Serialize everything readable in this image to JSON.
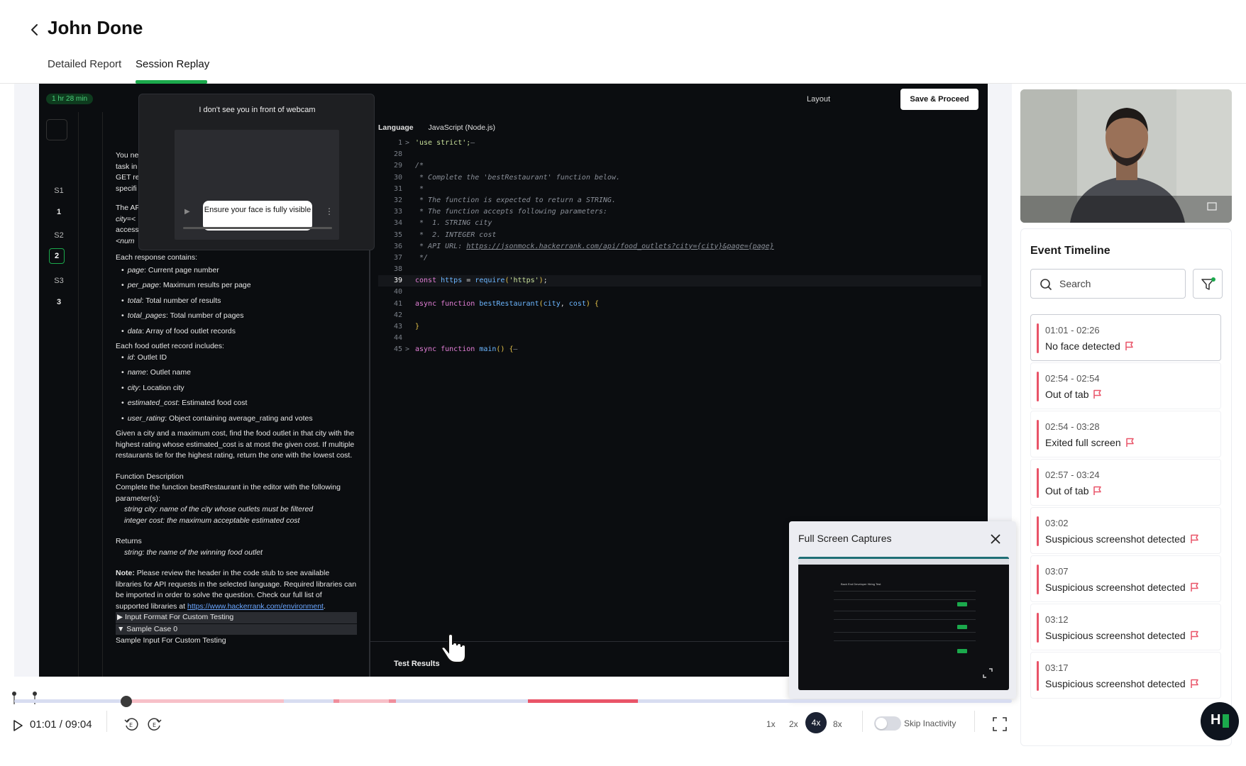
{
  "header": {
    "title": "John Done",
    "tabs": [
      {
        "label": "Detailed Report"
      },
      {
        "label": "Session Replay"
      }
    ]
  },
  "video": {
    "timer": "1 hr 28 min",
    "layout_label": "Layout",
    "save_button": "Save & Proceed",
    "question_nav": [
      "S1",
      "1",
      "S2",
      "2",
      "S3",
      "3"
    ],
    "webcam_warning": "I don't see you in front of webcam",
    "face_tooltip": "Ensure your face is fully visible",
    "language_label": "Language",
    "language_value": "JavaScript (Node.js)",
    "test_results": "Test Results",
    "problem": {
      "intro_fragments": [
        "You ne",
        "task in",
        "GET re",
        "specifi"
      ],
      "api_fragments": [
        "The AP",
        "city=<",
        "access",
        "<num"
      ],
      "response_heading": "Each response contains:",
      "response_items": [
        {
          "key": "page",
          "text": ": Current page number"
        },
        {
          "key": "per_page",
          "text": ": Maximum results per page"
        },
        {
          "key": "total",
          "text": ": Total number of results"
        },
        {
          "key": "total_pages",
          "text": ": Total number of pages"
        },
        {
          "key": "data",
          "text": ": Array of food outlet records"
        }
      ],
      "record_heading": "Each food outlet record includes:",
      "record_items": [
        {
          "key": "id",
          "text": ": Outlet ID"
        },
        {
          "key": "name",
          "text": ": Outlet name"
        },
        {
          "key": "city",
          "text": ": Location city"
        },
        {
          "key": "estimated_cost",
          "text": ": Estimated food cost"
        },
        {
          "key": "user_rating",
          "text": ": Object containing average_rating and votes"
        }
      ],
      "task": "Given a city and a maximum cost, find the food outlet in that city with the highest rating whose estimated_cost is at most the given cost. If multiple restaurants tie for the highest rating, return the one with the lowest cost.",
      "fd_heading": "Function Description",
      "fd_text": "Complete the function bestRestaurant in the editor with the following parameter(s):",
      "param1": "string city: name of the city whose outlets must be filtered",
      "param2": "integer cost: the maximum acceptable estimated cost",
      "returns_heading": "Returns",
      "returns_text": "string: the name of the winning food outlet",
      "note_label": "Note:",
      "note_text": " Please review the header in the code stub to see available libraries for API requests in the selected language. Required libraries can be imported in order to solve the question. Check our full list of supported libraries at ",
      "note_link": "https://www.hackerrank.com/environment",
      "input_format": "▶ Input Format For Custom Testing",
      "sample_case": "▼ Sample Case 0",
      "sample_input": "Sample Input For Custom Testing"
    },
    "code": [
      {
        "n": "1",
        "fold": ">",
        "parts": [
          [
            "c-str",
            "'use strict';"
          ],
          [
            "c-com",
            "—"
          ]
        ]
      },
      {
        "n": "28",
        "fold": "",
        "parts": []
      },
      {
        "n": "29",
        "fold": "",
        "parts": [
          [
            "c-com",
            "/*"
          ]
        ]
      },
      {
        "n": "30",
        "fold": "",
        "parts": [
          [
            "c-com",
            " * Complete the 'bestRestaurant' function below."
          ]
        ]
      },
      {
        "n": "31",
        "fold": "",
        "parts": [
          [
            "c-com",
            " *"
          ]
        ]
      },
      {
        "n": "32",
        "fold": "",
        "parts": [
          [
            "c-com",
            " * The function is expected to return a STRING."
          ]
        ]
      },
      {
        "n": "33",
        "fold": "",
        "parts": [
          [
            "c-com",
            " * The function accepts following parameters:"
          ]
        ]
      },
      {
        "n": "34",
        "fold": "",
        "parts": [
          [
            "c-com",
            " *  1. STRING city"
          ]
        ]
      },
      {
        "n": "35",
        "fold": "",
        "parts": [
          [
            "c-com",
            " *  2. INTEGER cost"
          ]
        ]
      },
      {
        "n": "36",
        "fold": "",
        "parts": [
          [
            "c-com",
            " * API URL: "
          ],
          [
            "c-url",
            "https://jsonmock.hackerrank.com/api/food_outlets?city={city}&page={page}"
          ]
        ]
      },
      {
        "n": "37",
        "fold": "",
        "parts": [
          [
            "c-com",
            " */"
          ]
        ]
      },
      {
        "n": "38",
        "fold": "",
        "parts": []
      },
      {
        "n": "39",
        "fold": "",
        "cur": true,
        "parts": [
          [
            "c-kw",
            "const "
          ],
          [
            "c-fn",
            "https"
          ],
          [
            "c-id",
            " = "
          ],
          [
            "c-fn",
            "require"
          ],
          [
            "c-br",
            "("
          ],
          [
            "c-str",
            "'https'"
          ],
          [
            "c-br",
            ")"
          ],
          [
            "c-id",
            ";"
          ]
        ]
      },
      {
        "n": "40",
        "fold": "",
        "parts": []
      },
      {
        "n": "41",
        "fold": "",
        "parts": [
          [
            "c-kw",
            "async function "
          ],
          [
            "c-fn",
            "bestRestaurant"
          ],
          [
            "c-br",
            "("
          ],
          [
            "c-fn",
            "city"
          ],
          [
            "c-id",
            ", "
          ],
          [
            "c-fn",
            "cost"
          ],
          [
            "c-br",
            ") {"
          ]
        ]
      },
      {
        "n": "42",
        "fold": "",
        "parts": []
      },
      {
        "n": "43",
        "fold": "",
        "parts": [
          [
            "c-br",
            "}"
          ]
        ]
      },
      {
        "n": "44",
        "fold": "",
        "parts": []
      },
      {
        "n": "45",
        "fold": ">",
        "parts": [
          [
            "c-kw",
            "async function "
          ],
          [
            "c-fn",
            "main"
          ],
          [
            "c-br",
            "() {"
          ],
          [
            "c-com",
            "—"
          ]
        ]
      }
    ]
  },
  "captures": {
    "title": "Full Screen Captures",
    "thumb_heading": "Back End Developer Hiring Test"
  },
  "playback": {
    "time": "01:01 / 09:04",
    "position_fraction": 0.112,
    "speeds": [
      "1x",
      "2x",
      "4x",
      "8x"
    ],
    "active_speed": "4x",
    "skip_inactivity": "Skip Inactivity",
    "skip_inactivity_on": false
  },
  "timeline": {
    "title": "Event Timeline",
    "search_placeholder": "Search",
    "accent": "#e95468",
    "events": [
      {
        "time": "01:01 - 02:26",
        "label": "No face detected",
        "selected": true
      },
      {
        "time": "02:54 - 02:54",
        "label": "Out of tab"
      },
      {
        "time": "02:54 - 03:28",
        "label": "Exited full screen"
      },
      {
        "time": "02:57 - 03:24",
        "label": "Out of tab"
      },
      {
        "time": "03:02",
        "label": "Suspicious screenshot detected"
      },
      {
        "time": "03:07",
        "label": "Suspicious screenshot detected"
      },
      {
        "time": "03:12",
        "label": "Suspicious screenshot detected"
      },
      {
        "time": "03:17",
        "label": "Suspicious screenshot detected"
      }
    ]
  },
  "colors": {
    "brand_green": "#1ba94c",
    "flag_red": "#e95468",
    "video_bg": "#0b0d10"
  }
}
